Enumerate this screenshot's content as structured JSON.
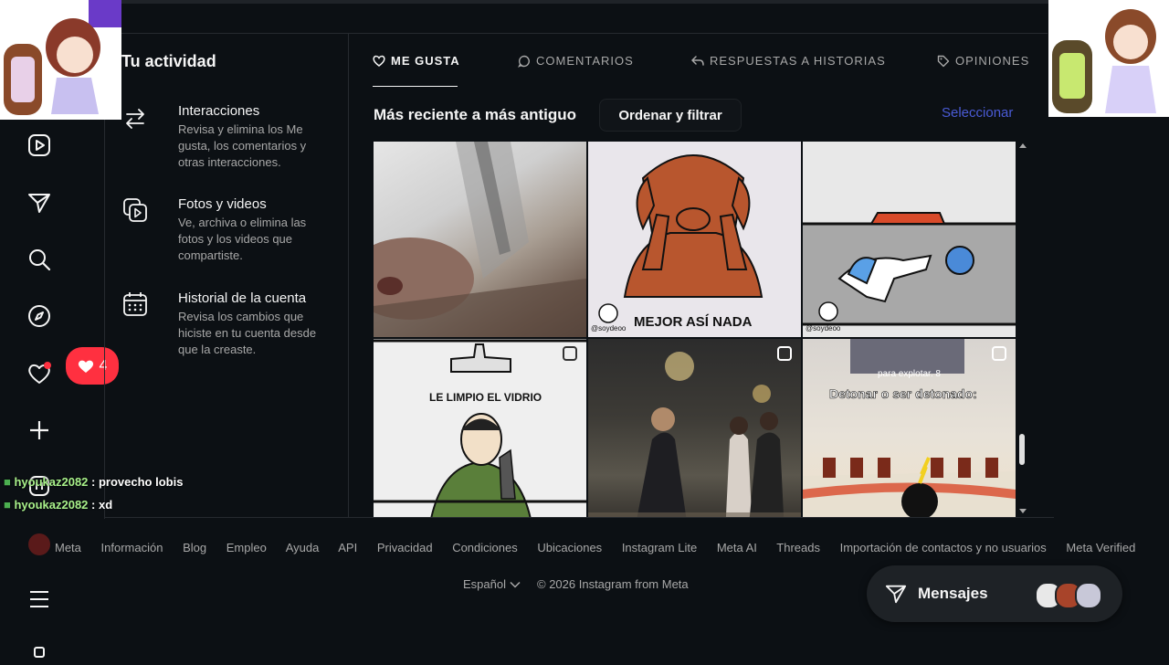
{
  "colors": {
    "bg": "#0c1014",
    "accent_link": "#4a5bd6",
    "notification": "#ff3040",
    "muted": "#a8a8a8"
  },
  "sidebar": {
    "icons": [
      "reels-icon",
      "send-icon",
      "search-icon",
      "explore-compass-icon",
      "heart-icon",
      "create-plus-icon",
      "threads-icon",
      "menu-icon"
    ],
    "notification_count": "4"
  },
  "activity": {
    "title": "Tu actividad",
    "items": [
      {
        "icon": "interactions-arrows-icon",
        "label": "Interacciones",
        "desc": "Revisa y elimina los Me gusta, los comentarios y otras interacciones."
      },
      {
        "icon": "photos-videos-icon",
        "label": "Fotos y videos",
        "desc": "Ve, archiva o elimina las fotos y los videos que compartiste."
      },
      {
        "icon": "calendar-icon",
        "label": "Historial de la cuenta",
        "desc": "Revisa los cambios que hiciste en tu cuenta desde que la creaste."
      }
    ]
  },
  "tabs": {
    "likes": "ME GUSTA",
    "comments": "COMENTARIOS",
    "story_replies": "RESPUESTAS A HISTORIAS",
    "reviews": "OPINIONES"
  },
  "toolbar": {
    "sort": "Más reciente a más antiguo",
    "filter_button": "Ordenar y filtrar",
    "select": "Seleccionar"
  },
  "grid": {
    "captions": {
      "dog": "MEJOR ASÍ NADA",
      "dog_watermark": "@soydeoo",
      "fall_watermark": "@soydeoo",
      "cleaner": "LE LIMPIO EL VIDRIO",
      "detonar": "Detonar o ser detonado:",
      "detonar_sub": "para explotar. 8"
    }
  },
  "chat": [
    {
      "user": "hyoukaz2082",
      "text": " : provecho lobis"
    },
    {
      "user": "hyoukaz2082",
      "text": " : xd"
    }
  ],
  "footer": {
    "links": [
      "Meta",
      "Información",
      "Blog",
      "Empleo",
      "Ayuda",
      "API",
      "Privacidad",
      "Condiciones",
      "Ubicaciones",
      "Instagram Lite",
      "Meta AI",
      "Threads",
      "Importación de contactos y no usuarios",
      "Meta Verified"
    ],
    "language": "Español",
    "copyright": "© 2026 Instagram from Meta"
  },
  "messages": {
    "label": "Mensajes"
  }
}
